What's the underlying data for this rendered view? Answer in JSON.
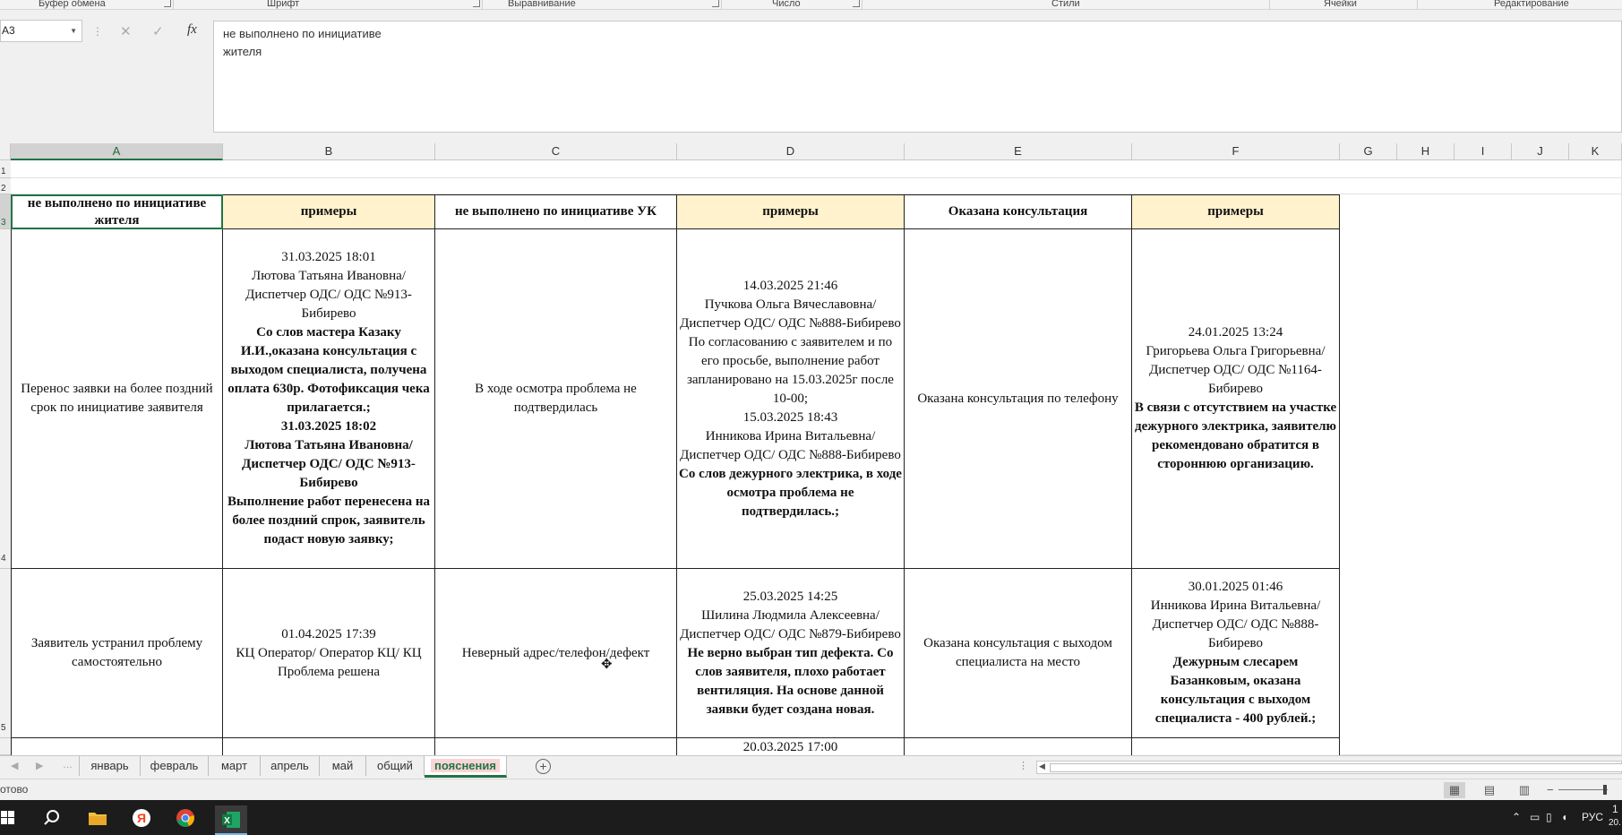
{
  "ribbon": {
    "groups": [
      "Буфер обмена",
      "Шрифт",
      "Выравнивание",
      "Число",
      "Стили",
      "Ячейки",
      "Редактирование"
    ]
  },
  "formula_bar": {
    "name_box": "A3",
    "fx_label": "fx",
    "content": "не выполнено по инициативе\nжителя"
  },
  "columns": [
    "A",
    "B",
    "C",
    "D",
    "E",
    "F",
    "G",
    "H",
    "I",
    "J",
    "K"
  ],
  "selected_column": "A",
  "rows": [
    "1",
    "2",
    "3",
    "4",
    "5"
  ],
  "selected_row": "3",
  "header_row": {
    "a": "не выполнено по инициативе жителя",
    "b": "примеры",
    "c": "не выполнено по инициативе УК",
    "d": "примеры",
    "e": "Оказана консультация",
    "f": "примеры"
  },
  "row4": {
    "a": "Перенос заявки на более поздний срок по инициативе заявителя",
    "b_lines": [
      {
        "text": "31.03.2025 18:01",
        "bold": false
      },
      {
        "text": "Лютова Татьяна Ивановна/ Диспетчер ОДС/ ОДС №913-Бибирево",
        "bold": false
      },
      {
        "text": "Со слов мастера Казаку И.И.,оказана консультация с выходом специалиста, получена оплата 630р. Фотофиксация чека прилагается.;",
        "bold": true
      },
      {
        "text": "31.03.2025 18:02",
        "bold": true
      },
      {
        "text": "Лютова Татьяна Ивановна/ Диспетчер ОДС/ ОДС №913-Бибирево",
        "bold": true
      },
      {
        "text": "Выполнение работ перенесена на более поздний спрок, заявитель подаст новую заявку;",
        "bold": true
      }
    ],
    "c": "В ходе осмотра проблема не подтвердилась",
    "d_lines": [
      {
        "text": "14.03.2025 21:46",
        "bold": false
      },
      {
        "text": "Пучкова Ольга Вячеславовна/ Диспетчер ОДС/ ОДС №888-Бибирево",
        "bold": false
      },
      {
        "text": "По согласованию с заявителем и по его просьбе, выполнение работ запланировано на 15.03.2025г после 10-00;",
        "bold": false
      },
      {
        "text": "15.03.2025 18:43",
        "bold": false
      },
      {
        "text": "Инникова Ирина Витальевна/ Диспетчер ОДС/ ОДС №888-Бибирево",
        "bold": false
      },
      {
        "text": "Со слов дежурного электрика, в ходе осмотра проблема не подтвердилась.;",
        "bold": true
      }
    ],
    "e": "Оказана консультация по телефону",
    "f_lines": [
      {
        "text": "24.01.2025 13:24",
        "bold": false
      },
      {
        "text": "Григорьева Ольга Григорьевна/ Диспетчер ОДС/ ОДС №1164-Бибирево",
        "bold": false
      },
      {
        "text": "В связи с отсутствием на участке дежурного электрика, заявителю рекомендовано обратится в стороннюю организацию.",
        "bold": true
      }
    ]
  },
  "row5": {
    "a": "Заявитель устранил проблему самостоятельно",
    "b_lines": [
      {
        "text": "01.04.2025 17:39",
        "bold": false
      },
      {
        "text": "КЦ Оператор/ Оператор КЦ/ КЦ Проблема решена",
        "bold": false
      }
    ],
    "c": "Неверный адрес/телефон/дефект",
    "d_lines": [
      {
        "text": "25.03.2025 14:25",
        "bold": false
      },
      {
        "text": "Шилина Людмила Алексеевна/ Диспетчер ОДС/ ОДС №879-Бибирево",
        "bold": false
      },
      {
        "text": "Не верно выбран тип дефекта. Со слов заявителя, плохо работает вентиляция. На основе данной заявки будет создана новая.",
        "bold": true
      }
    ],
    "e": "Оказана консультация с выходом специалиста на место",
    "f_lines": [
      {
        "text": "30.01.2025 01:46",
        "bold": false
      },
      {
        "text": "Инникова Ирина Витальевна/ Диспетчер ОДС/ ОДС №888-Бибирево",
        "bold": false
      },
      {
        "text": "Дежурным слесарем Базанковым, оказана консультация с выходом специалиста - 400 рублей.;",
        "bold": true
      }
    ]
  },
  "row6": {
    "d": "20.03.2025 17:00"
  },
  "sheet_tabs": [
    {
      "label": "январь",
      "active": false
    },
    {
      "label": "февраль",
      "active": false
    },
    {
      "label": "март",
      "active": false
    },
    {
      "label": "апрель",
      "active": false
    },
    {
      "label": "май",
      "active": false
    },
    {
      "label": "общий",
      "active": false
    },
    {
      "label": "пояснения",
      "active": true
    }
  ],
  "status": {
    "ready": "отово"
  },
  "taskbar": {
    "language": "РУС",
    "clock_fragment": "1",
    "date_fragment": "20."
  },
  "colors": {
    "accent": "#217346",
    "header_fill": "#fff2cc",
    "active_tab_fill": "#f8d6d6"
  }
}
